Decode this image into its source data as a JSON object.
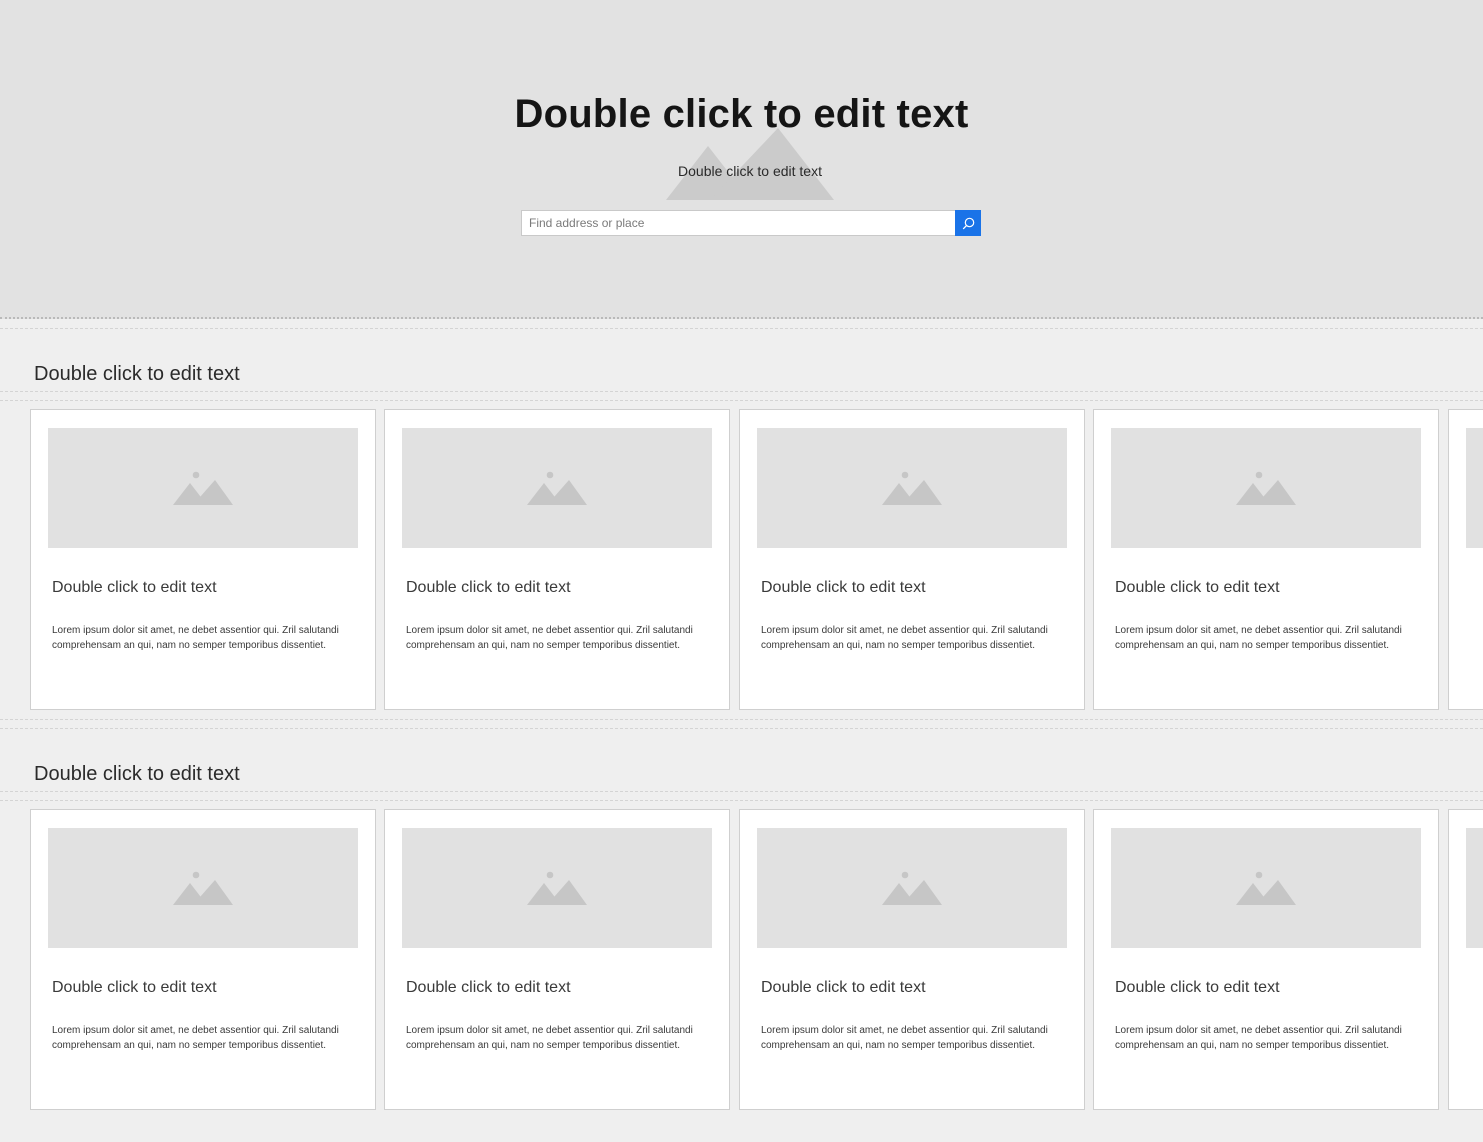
{
  "hero": {
    "title": "Double click to edit text",
    "subtitle": "Double click to edit text",
    "search": {
      "placeholder": "Find address or place",
      "icon": "search-icon"
    },
    "background_icon": "image-placeholder-icon"
  },
  "sections": [
    {
      "title": "Double click to edit text",
      "cards": [
        {
          "title": "Double click to edit text",
          "body": "Lorem ipsum dolor sit amet, ne debet assentior qui. Zril salutandi comprehensam an qui, nam no semper temporibus dissentiet."
        },
        {
          "title": "Double click to edit text",
          "body": "Lorem ipsum dolor sit amet, ne debet assentior qui. Zril salutandi comprehensam an qui, nam no semper temporibus dissentiet."
        },
        {
          "title": "Double click to edit text",
          "body": "Lorem ipsum dolor sit amet, ne debet assentior qui. Zril salutandi comprehensam an qui, nam no semper temporibus dissentiet."
        },
        {
          "title": "Double click to edit text",
          "body": "Lorem ipsum dolor sit amet, ne debet assentior qui. Zril salutandi comprehensam an qui, nam no semper temporibus dissentiet."
        }
      ]
    },
    {
      "title": "Double click to edit text",
      "cards": [
        {
          "title": "Double click to edit text",
          "body": "Lorem ipsum dolor sit amet, ne debet assentior qui. Zril salutandi comprehensam an qui, nam no semper temporibus dissentiet."
        },
        {
          "title": "Double click to edit text",
          "body": "Lorem ipsum dolor sit amet, ne debet assentior qui. Zril salutandi comprehensam an qui, nam no semper temporibus dissentiet."
        },
        {
          "title": "Double click to edit text",
          "body": "Lorem ipsum dolor sit amet, ne debet assentior qui. Zril salutandi comprehensam an qui, nam no semper temporibus dissentiet."
        },
        {
          "title": "Double click to edit text",
          "body": "Lorem ipsum dolor sit amet, ne debet assentior qui. Zril salutandi comprehensam an qui, nam no semper temporibus dissentiet."
        }
      ]
    }
  ],
  "colors": {
    "hero_background": "#e2e2e2",
    "page_background": "#efefef",
    "card_background": "#ffffff",
    "image_placeholder": "#e1e1e1",
    "placeholder_icon": "#c6c6c6",
    "search_button": "#1a73e8"
  },
  "card_image_icon": "image-placeholder-icon"
}
